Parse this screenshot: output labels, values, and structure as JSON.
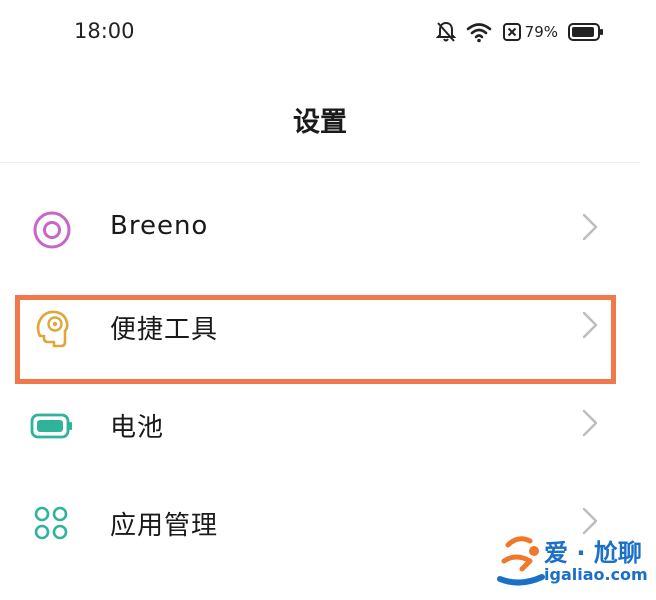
{
  "status_bar": {
    "time": "18:00",
    "battery_percent": "79%",
    "icons": [
      "bell-off-icon",
      "wifi-icon",
      "sim-blocked-icon",
      "battery-icon"
    ]
  },
  "header": {
    "title": "设置"
  },
  "settings_items": [
    {
      "label": "Breeno",
      "icon": "breeno-icon",
      "icon_color": "#c865c8"
    },
    {
      "label": "便捷工具",
      "icon": "convenience-tools-icon",
      "icon_color": "#e0a63a"
    },
    {
      "label": "电池",
      "icon": "battery-settings-icon",
      "icon_color": "#2fb39a"
    },
    {
      "label": "应用管理",
      "icon": "app-management-icon",
      "icon_color": "#2fb39a"
    }
  ],
  "highlight": {
    "color": "#f0784a",
    "target": "便捷工具"
  },
  "watermark": {
    "title": "爱 · 尬聊",
    "url": "igaliao.com",
    "color": "#1a6fc9"
  }
}
